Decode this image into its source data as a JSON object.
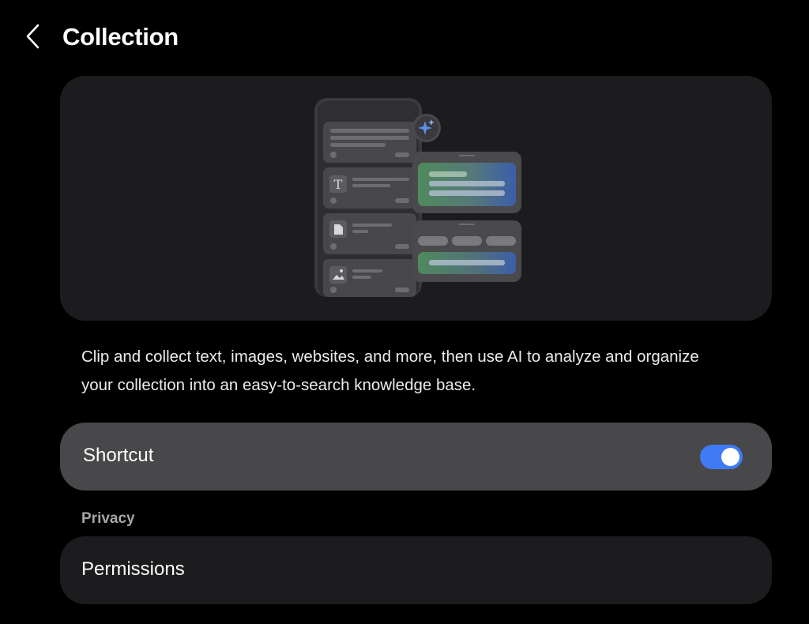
{
  "header": {
    "back_icon": "chevron-left-icon",
    "title": "Collection"
  },
  "hero": {
    "illustration": "collection-illustration",
    "sparkle_icon": "ai-sparkle-icon",
    "text_icon_glyph": "T",
    "toggle_color": "#3e7bf5"
  },
  "description": "Clip and collect text, images, websites, and more, then use AI to analyze and organize your collection into an easy-to-search knowledge base.",
  "shortcut": {
    "label": "Shortcut",
    "enabled": true
  },
  "privacy": {
    "section_label": "Privacy",
    "permissions_label": "Permissions"
  }
}
